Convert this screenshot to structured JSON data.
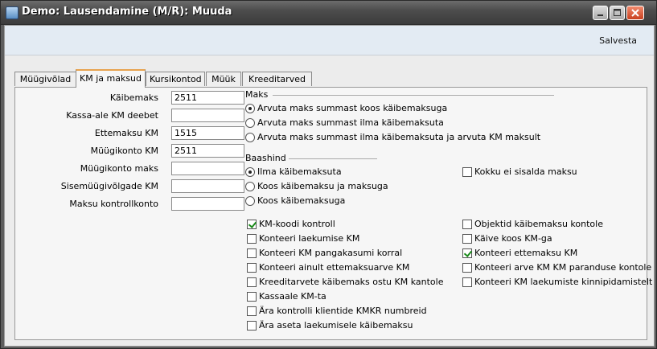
{
  "window": {
    "title": "Demo: Lausendamine (M/R): Muuda"
  },
  "toolbar": {
    "save_label": "Salvesta"
  },
  "tabs": [
    {
      "label": "Müügivõlad"
    },
    {
      "label": "KM ja maksud"
    },
    {
      "label": "Kursikontod"
    },
    {
      "label": "Müük"
    },
    {
      "label": "Kreeditarved"
    }
  ],
  "fields": [
    {
      "label": "Käibemaks",
      "value": "2511"
    },
    {
      "label": "Kassa-ale KM deebet",
      "value": ""
    },
    {
      "label": "Ettemaksu KM",
      "value": "1515"
    },
    {
      "label": "Müügikonto KM",
      "value": "2511"
    },
    {
      "label": "Müügikonto maks",
      "value": ""
    },
    {
      "label": "Sisemüügivõlgade KM",
      "value": ""
    },
    {
      "label": "Maksu kontrollkonto",
      "value": ""
    }
  ],
  "maks": {
    "title": "Maks",
    "options": [
      {
        "label": "Arvuta maks summast koos käibemaksuga",
        "selected": true
      },
      {
        "label": "Arvuta maks summast ilma käibemaksuta",
        "selected": false
      },
      {
        "label": "Arvuta maks summast ilma käibemaksuta ja arvuta KM maksult",
        "selected": false
      }
    ]
  },
  "baashind": {
    "title": "Baashind",
    "options": [
      {
        "label": "Ilma käibemaksuta",
        "selected": true
      },
      {
        "label": "Koos käibemaksu ja maksuga",
        "selected": false
      },
      {
        "label": "Koos käibemaksuga",
        "selected": false
      }
    ],
    "kokku": {
      "label": "Kokku ei sisalda maksu",
      "checked": false
    }
  },
  "checks_left": [
    {
      "label": "KM-koodi kontroll",
      "checked": true
    },
    {
      "label": "Konteeri laekumise KM",
      "checked": false
    },
    {
      "label": "Konteeri KM pangakasumi korral",
      "checked": false
    },
    {
      "label": "Konteeri ainult ettemaksuarve KM",
      "checked": false
    },
    {
      "label": "Kreeditarvete käibemaks ostu KM kantole",
      "checked": false
    },
    {
      "label": "Kassaale KM-ta",
      "checked": false
    },
    {
      "label": "Ära kontrolli klientide KMKR numbreid",
      "checked": false
    },
    {
      "label": "Ära aseta laekumisele käibemaksu",
      "checked": false
    }
  ],
  "checks_right": [
    {
      "label": "Objektid käibemaksu kontole",
      "checked": false
    },
    {
      "label": "Käive koos KM-ga",
      "checked": false
    },
    {
      "label": "Konteeri ettemaksu KM",
      "checked": true
    },
    {
      "label": "Konteeri arve KM KM paranduse kontole",
      "checked": false
    },
    {
      "label": "Konteeri KM laekumiste kinnipidamistelt",
      "checked": false
    }
  ]
}
